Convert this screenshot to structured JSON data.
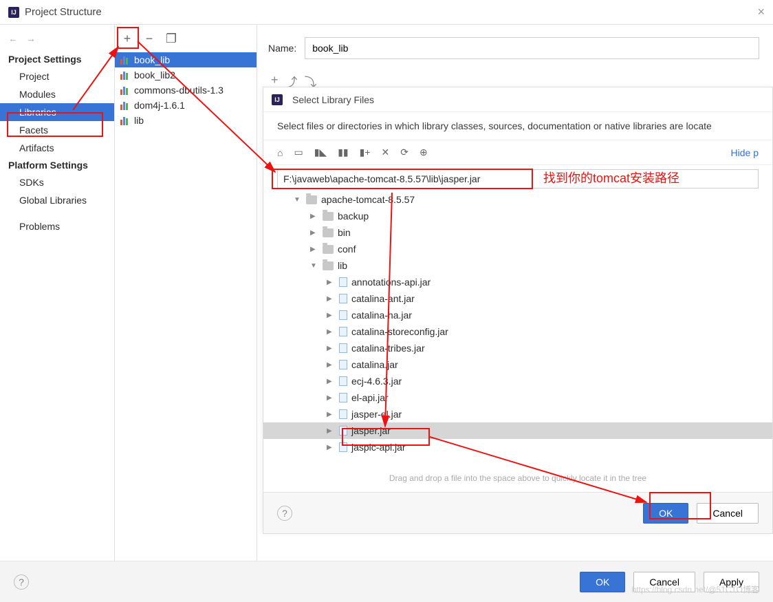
{
  "window": {
    "title": "Project Structure",
    "close": "×"
  },
  "nav": {
    "back": "←",
    "fwd": "→"
  },
  "sidebar": {
    "section1": "Project Settings",
    "items1": [
      "Project",
      "Modules",
      "Libraries",
      "Facets",
      "Artifacts"
    ],
    "selected1": 2,
    "section2": "Platform Settings",
    "items2": [
      "SDKs",
      "Global Libraries"
    ],
    "section3": "",
    "items3": [
      "Problems"
    ]
  },
  "lib_toolbar": {
    "add": "+",
    "remove": "−",
    "copy": "❐"
  },
  "libraries": [
    "book_lib",
    "book_lib2",
    "commons-dbutils-1.3",
    "dom4j-1.6.1",
    "lib"
  ],
  "lib_selected": 0,
  "name_field": {
    "label": "Name:",
    "value": "book_lib"
  },
  "mini_tb": [
    "+",
    "⤴",
    "⤵"
  ],
  "dialog": {
    "title": "Select Library Files",
    "subtitle": "Select files or directories in which library classes, sources, documentation or native libraries are locate",
    "toolbar_icons": [
      "⌂",
      "▭",
      "▮◣",
      "▮▮",
      "▮+",
      "✕",
      "⟳",
      "⊕"
    ],
    "hide_path": "Hide p",
    "path": "F:\\javaweb\\apache-tomcat-8.5.57\\lib\\jasper.jar",
    "tree": [
      {
        "depth": 1,
        "type": "folder",
        "name": "apache-tomcat-8.5.57",
        "arrow": "▼"
      },
      {
        "depth": 2,
        "type": "folder",
        "name": "backup",
        "arrow": "▶"
      },
      {
        "depth": 2,
        "type": "folder",
        "name": "bin",
        "arrow": "▶"
      },
      {
        "depth": 2,
        "type": "folder",
        "name": "conf",
        "arrow": "▶"
      },
      {
        "depth": 2,
        "type": "folder",
        "name": "lib",
        "arrow": "▼"
      },
      {
        "depth": 3,
        "type": "jar",
        "name": "annotations-api.jar",
        "arrow": "▶"
      },
      {
        "depth": 3,
        "type": "jar",
        "name": "catalina-ant.jar",
        "arrow": "▶"
      },
      {
        "depth": 3,
        "type": "jar",
        "name": "catalina-ha.jar",
        "arrow": "▶"
      },
      {
        "depth": 3,
        "type": "jar",
        "name": "catalina-storeconfig.jar",
        "arrow": "▶"
      },
      {
        "depth": 3,
        "type": "jar",
        "name": "catalina-tribes.jar",
        "arrow": "▶"
      },
      {
        "depth": 3,
        "type": "jar",
        "name": "catalina.jar",
        "arrow": "▶"
      },
      {
        "depth": 3,
        "type": "jar",
        "name": "ecj-4.6.3.jar",
        "arrow": "▶"
      },
      {
        "depth": 3,
        "type": "jar",
        "name": "el-api.jar",
        "arrow": "▶"
      },
      {
        "depth": 3,
        "type": "jar",
        "name": "jasper-el.jar",
        "arrow": "▶"
      },
      {
        "depth": 3,
        "type": "jar",
        "name": "jasper.jar",
        "arrow": "▶",
        "selected": true
      },
      {
        "depth": 3,
        "type": "jar",
        "name": "jaspic-api.jar",
        "arrow": "▶"
      }
    ],
    "drag_hint": "Drag and drop a file into the space above to quickly locate it in the tree",
    "ok": "OK",
    "cancel": "Cancel"
  },
  "footer": {
    "ok": "OK",
    "cancel": "Cancel",
    "apply": "Apply"
  },
  "annotation_text": "找到你的tomcat安装路径",
  "watermark": "https://blog.csdn.net/@51CTO博客"
}
